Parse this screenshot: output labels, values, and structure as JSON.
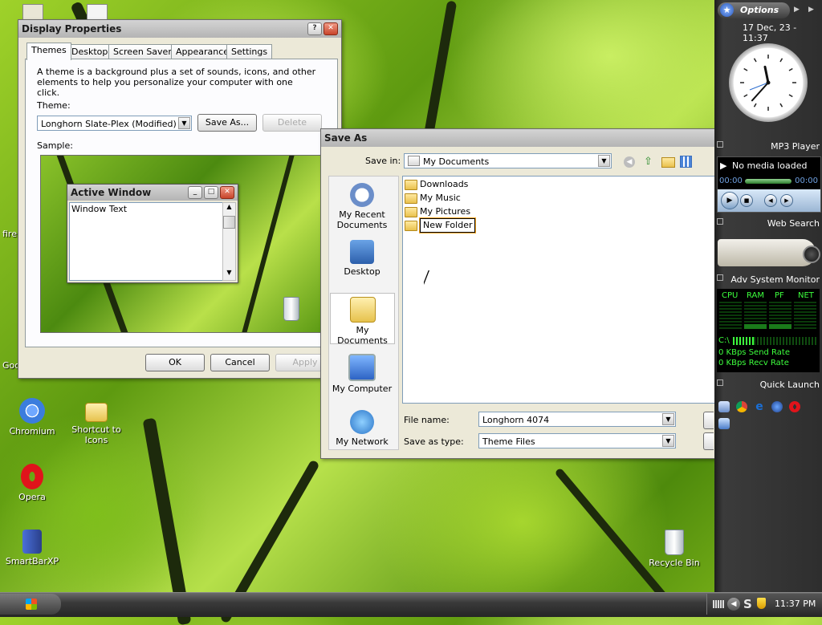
{
  "desktop": {
    "icons": [
      {
        "name": "Chromium"
      },
      {
        "name": "Shortcut to Icons"
      },
      {
        "name": "Opera"
      },
      {
        "name": "SmartBarXP"
      },
      {
        "name": "Recycle Bin"
      }
    ],
    "partial_labels": {
      "left_fire": "firel",
      "left_goo": "Goo"
    }
  },
  "display_properties": {
    "title": "Display Properties",
    "tabs": [
      "Themes",
      "Desktop",
      "Screen Saver",
      "Appearance",
      "Settings"
    ],
    "selected_tab": "Themes",
    "description": "A theme is a background plus a set of sounds, icons, and other elements to help you personalize your computer with one click.",
    "theme_label": "Theme:",
    "theme_value": "Longhorn Slate-Plex (Modified)",
    "save_as_button": "Save As...",
    "delete_button": "Delete",
    "sample_label": "Sample:",
    "active_window_title": "Active Window",
    "window_text": "Window Text",
    "ok_button": "OK",
    "cancel_button": "Cancel",
    "apply_button": "Apply"
  },
  "save_as": {
    "title": "Save As",
    "save_in_label": "Save in:",
    "save_in_value": "My Documents",
    "places": [
      "My Recent Documents",
      "Desktop",
      "My Documents",
      "My Computer",
      "My Network"
    ],
    "selected_place": "My Documents",
    "files": [
      "Downloads",
      "My Music",
      "My Pictures",
      "New Folder"
    ],
    "file_name_label": "File name:",
    "file_name_value": "Longhorn 4074",
    "save_type_label": "Save as type:",
    "save_type_value": "Theme Files"
  },
  "sidebar": {
    "options_label": "Options",
    "datetime": "17 Dec, 23 - 11:37",
    "clock": {
      "hour": 11,
      "minute": 37
    },
    "mp3_title": "MP3 Player",
    "mp3_status": "No media loaded",
    "mp3_time_start": "00:00",
    "mp3_time_end": "00:00",
    "web_search_title": "Web Search",
    "monitor_title": "Adv System Monitor",
    "monitor_cols": [
      "CPU",
      "RAM",
      "PF",
      "NET"
    ],
    "drive_label": "C:\\",
    "send_rate": "0 KBps Send Rate",
    "recv_rate": "0 KBps Recv Rate",
    "quick_launch_title": "Quick Launch"
  },
  "taskbar": {
    "time": "11:37 PM"
  },
  "colors": {
    "sidebar_bg": "#2d2d2d",
    "monitor_green": "#3dff3d",
    "selection_orange": "#f5a623"
  }
}
